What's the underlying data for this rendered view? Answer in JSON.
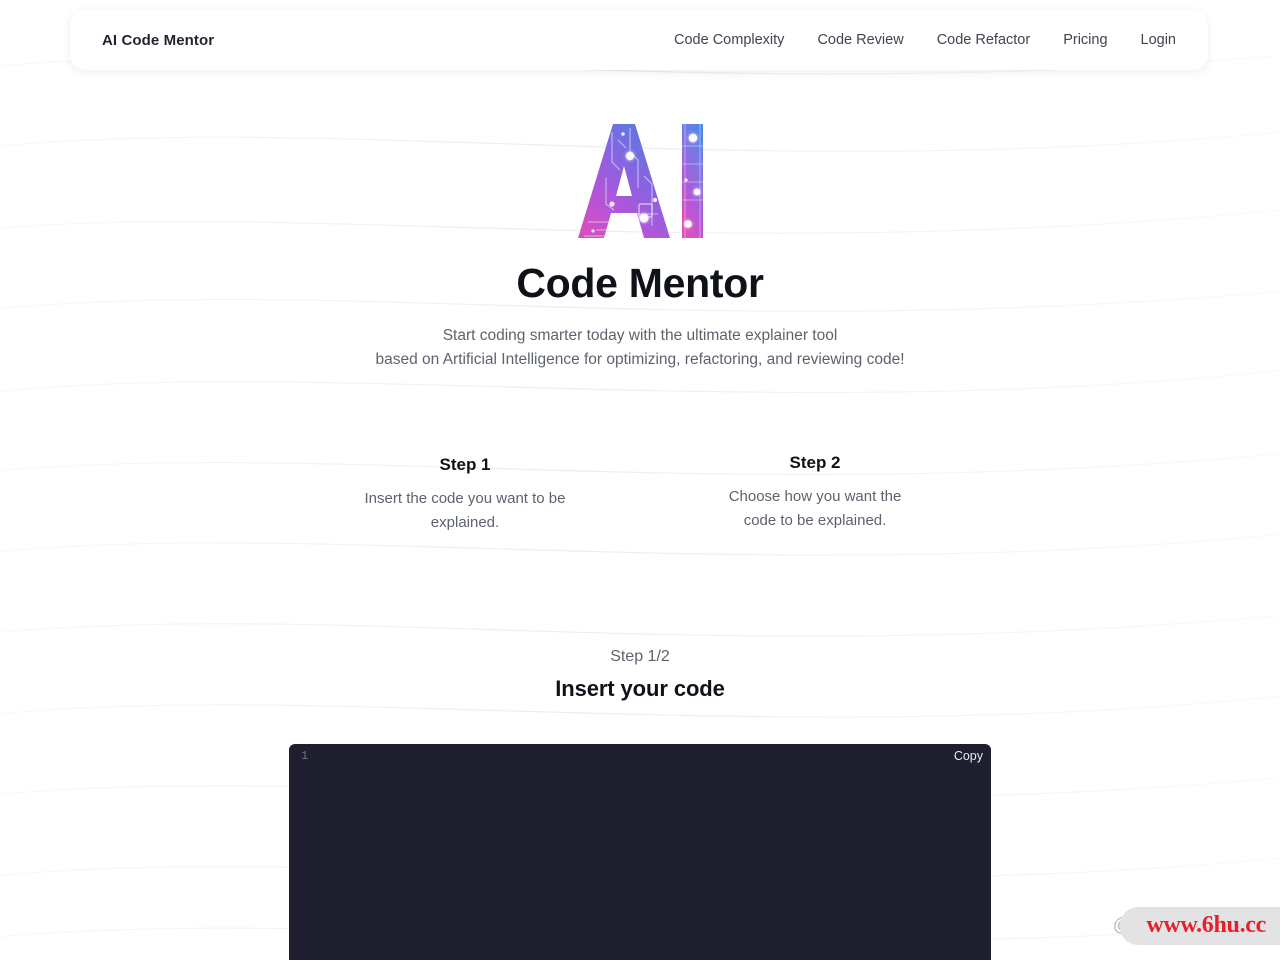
{
  "header": {
    "brand": "AI Code Mentor",
    "nav": [
      {
        "label": "Code Complexity"
      },
      {
        "label": "Code Review"
      },
      {
        "label": "Code Refactor"
      },
      {
        "label": "Pricing"
      },
      {
        "label": "Login"
      }
    ]
  },
  "hero": {
    "logo_alt": "AI",
    "logo_letters": "AI",
    "title": "Code Mentor",
    "subtitle_line1": "Start coding smarter today with the ultimate explainer tool",
    "subtitle_line2": "based on Artificial Intelligence for optimizing, refactoring, and reviewing code!"
  },
  "steps": [
    {
      "title": "Step 1",
      "desc_line1": "Insert the code you want to be",
      "desc_line2": "explained."
    },
    {
      "title": "Step 2",
      "desc_line1": "Choose how you want the",
      "desc_line2": "code to be explained."
    }
  ],
  "editor": {
    "step_counter": "Step 1/2",
    "heading": "Insert your code",
    "line_number": "1",
    "copy_label": "Copy",
    "code_value": "",
    "code_placeholder": ""
  },
  "watermark": {
    "handle": "@f",
    "site": "www.6hu.cc"
  },
  "colors": {
    "accent_purple": "#9b59d0",
    "accent_blue": "#4f7fe0",
    "accent_pink": "#d858c8",
    "editor_bg": "#1e1e2e",
    "text_dark": "#10121a",
    "text_muted": "#5d636e",
    "watermark_red": "#e8202a"
  }
}
